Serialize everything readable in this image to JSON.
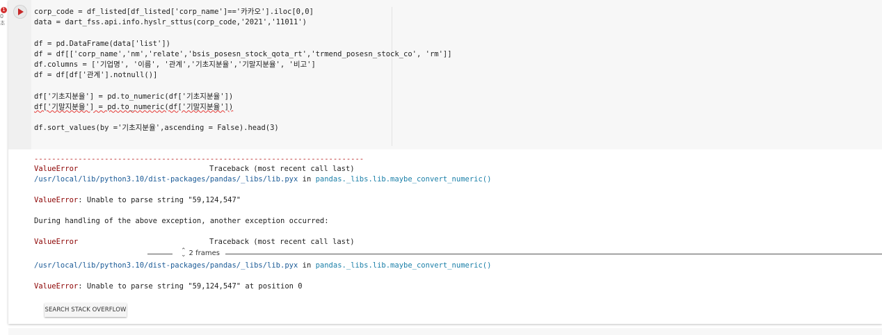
{
  "cell": {
    "error_badge": "1",
    "exec_count": "0초",
    "code_lines": [
      "corp_code = df_listed[df_listed['corp_name']=='카카오'].iloc[0,0]",
      "data = dart_fss.api.info.hyslr_sttus(corp_code,'2021','11011')",
      "",
      "df = pd.DataFrame(data['list'])",
      "df = df[['corp_name','nm','relate','bsis_posesn_stock_qota_rt','trmend_posesn_stock_co', 'rm']]",
      "df.columns = ['기업명', '이름', '관계','기초지분율','기말지분율', '비고']",
      "df = df[df['관계'].notnull()]",
      "",
      "df['기초지분율'] = pd.to_numeric(df['기초지분율'])",
      "df['기말지분율'] = pd.to_numeric(df['기말지분율'])",
      "",
      "df.sort_values(by ='기초지분율',ascending = False).head(3)"
    ]
  },
  "output": {
    "dashes": "---------------------------------------------------------------------------",
    "err1_name": "ValueError",
    "err1_trace": "Traceback (most recent call last)",
    "path1": "/usr/local/lib/python3.10/dist-packages/pandas/_libs/lib.pyx",
    "path1_in": " in ",
    "path1_fn": "pandas._libs.lib.maybe_convert_numeric()",
    "msg1_name": "ValueError",
    "msg1": ": Unable to parse string \"59,124,547\"",
    "during": "During handling of the above exception, another exception occurred:",
    "err2_name": "ValueError",
    "err2_trace": "Traceback (most recent call last)",
    "frames_label": "2 frames",
    "path2": "/usr/local/lib/python3.10/dist-packages/pandas/_libs/lib.pyx",
    "path2_in": " in ",
    "path2_fn": "pandas._libs.lib.maybe_convert_numeric()",
    "msg2_name": "ValueError",
    "msg2": ": Unable to parse string \"59,124,547\" at position 0",
    "so_button": "SEARCH STACK OVERFLOW"
  }
}
